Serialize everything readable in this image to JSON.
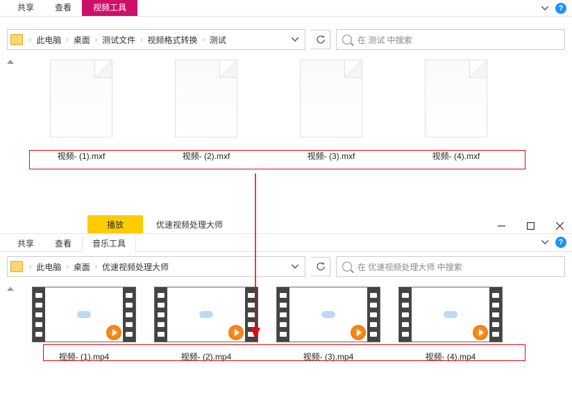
{
  "window1": {
    "tabs": {
      "share": "共享",
      "view": "查看",
      "contextLabel": "视频工具"
    },
    "breadcrumb": [
      "此电脑",
      "桌面",
      "测试文件",
      "视频格式转换",
      "测试"
    ],
    "searchPlaceholder": "在 测试 中搜索",
    "files": [
      {
        "name": "视频- (1).mxf"
      },
      {
        "name": "视频- (2).mxf"
      },
      {
        "name": "视频- (3).mxf"
      },
      {
        "name": "视频- (4).mxf"
      }
    ]
  },
  "window2": {
    "tabs": {
      "share": "共享",
      "view": "查看",
      "contextColor": "播放",
      "contextLabel": "音乐工具",
      "appTitle": "优速视频处理大师"
    },
    "breadcrumb": [
      "此电脑",
      "桌面",
      "优速视频处理大师"
    ],
    "searchPlaceholder": "在 优速视频处理大师 中搜索",
    "files": [
      {
        "name": "视频- (1).mp4"
      },
      {
        "name": "视频- (2).mp4"
      },
      {
        "name": "视频- (3).mp4"
      },
      {
        "name": "视频- (4).mp4"
      }
    ]
  }
}
